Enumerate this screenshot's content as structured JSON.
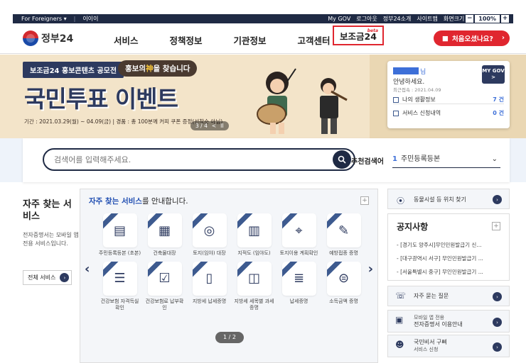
{
  "topbar": {
    "foreigners": "For Foreigners",
    "easy": "이이이",
    "mygov": "My GOV",
    "login": "로그아웃",
    "intro": "정부24소개",
    "sitemap": "사이트맵",
    "zoom_label": "화면크기",
    "zoom_minus": "−",
    "zoom_value": "100%",
    "zoom_plus": "+"
  },
  "header": {
    "logo": "정부24",
    "nav": [
      "서비스",
      "정책정보",
      "기관정보",
      "고객센터",
      "보조금24"
    ],
    "beta": "beta",
    "first_visit": "처음오셨나요?"
  },
  "banner": {
    "tag": "보조금24 홍보콘텐츠 공모전",
    "slogan_pre": "홍보의",
    "slogan_hl": "神",
    "slogan_post": "을 찾습니다",
    "title": "국민투표 이벤트",
    "period": "기간 : 2021.03.29(월) ~ 04.09(금) | 경품 : 총 100분께 커피 쿠폰 증정(선착순 아님)",
    "pager": "3 / 4",
    "pager_prev": "<",
    "pager_pause": "II"
  },
  "user_card": {
    "suffix": "님",
    "greeting": "안녕하세요.",
    "last_login": "최근접속 : 2021.04.09",
    "mygov_btn": "MY GOV >",
    "rows": [
      {
        "label": "나의 생활정보",
        "count": "7 건"
      },
      {
        "label": "서비스 신청내역",
        "count": "0 건"
      }
    ]
  },
  "search": {
    "placeholder": "검색어를 입력해주세요.",
    "recommend_label": "추천검색어",
    "recommend_num": "1",
    "recommend_value": "주민등록등본"
  },
  "left": {
    "heading": "자주 찾는 서비스",
    "desc": "전자증명서는 모바일 앱 전용 서비스입니다.",
    "all_button": "전체 서비스"
  },
  "services": {
    "title_blue": "자주 찾는 서비스",
    "title_rest": "를 안내합니다.",
    "pager": "1 / 2",
    "items": [
      "주민등록등본 (초본)",
      "건축물대장",
      "토지(임야) 대장",
      "지적도 (임야도)",
      "토지이용 계획확인",
      "예방접종 증명",
      "건강보험 자격득실확인",
      "건강보험료 납부확인",
      "지방세 납세증명",
      "지방세 세목별 과세증명",
      "납세증명",
      "소득금액 증명"
    ]
  },
  "right": {
    "facility": "동물시설 등 위치 찾기",
    "notice_title": "공지사항",
    "notices": [
      "[경기도 양주시]무인민원발급기 신...",
      "[대구광역시 서구] 무인민원발급기 ...",
      "[서울특별시 중구] 무인민원발급기 ..."
    ],
    "faq": "자주 묻는 질문",
    "mobile_line1": "모바일 앱 전용",
    "mobile_line2": "전자증명서 이용안내",
    "secretary_line1": "국민비서 구삐",
    "secretary_line2": "서비스 신청"
  }
}
